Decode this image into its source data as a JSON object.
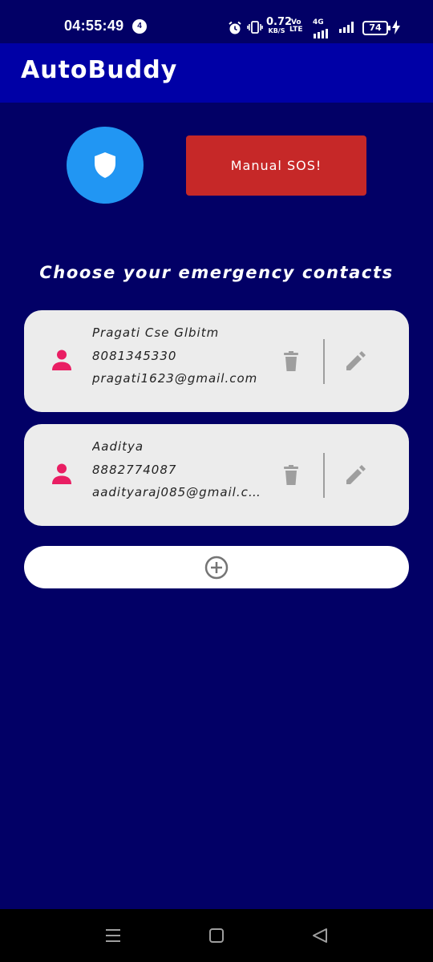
{
  "status_bar": {
    "time": "04:55:49",
    "notification_count": "4",
    "net_speed_value": "0.72",
    "net_speed_unit": "KB/S",
    "volte_top": "Vo",
    "volte_bottom": "LTE",
    "network_type": "4G",
    "battery_level": "74",
    "icons": [
      "alarm-icon",
      "vibrate-icon",
      "signal-icon",
      "battery-icon",
      "charging-icon"
    ]
  },
  "app_bar": {
    "title": "AutoBuddy"
  },
  "actions": {
    "shield_icon": "shield-icon",
    "sos_label": "Manual SOS!"
  },
  "section": {
    "heading": "Choose your emergency contacts"
  },
  "contacts": [
    {
      "name": "Pragati Cse Glbitm",
      "phone": "8081345330",
      "email": "pragati1623@gmail.com"
    },
    {
      "name": "Aaditya",
      "phone": "8882774087",
      "email": "aadityaraj085@gmail.c..."
    }
  ],
  "colors": {
    "background": "#020066",
    "app_bar": "#0000a6",
    "shield_button": "#2196f3",
    "sos_button": "#c62828",
    "card": "#ececec",
    "person_icon": "#e91e63",
    "action_icons": "#9e9e9e"
  },
  "nav_bar": {
    "icons": [
      "menu-icon",
      "home-icon",
      "back-icon"
    ]
  }
}
